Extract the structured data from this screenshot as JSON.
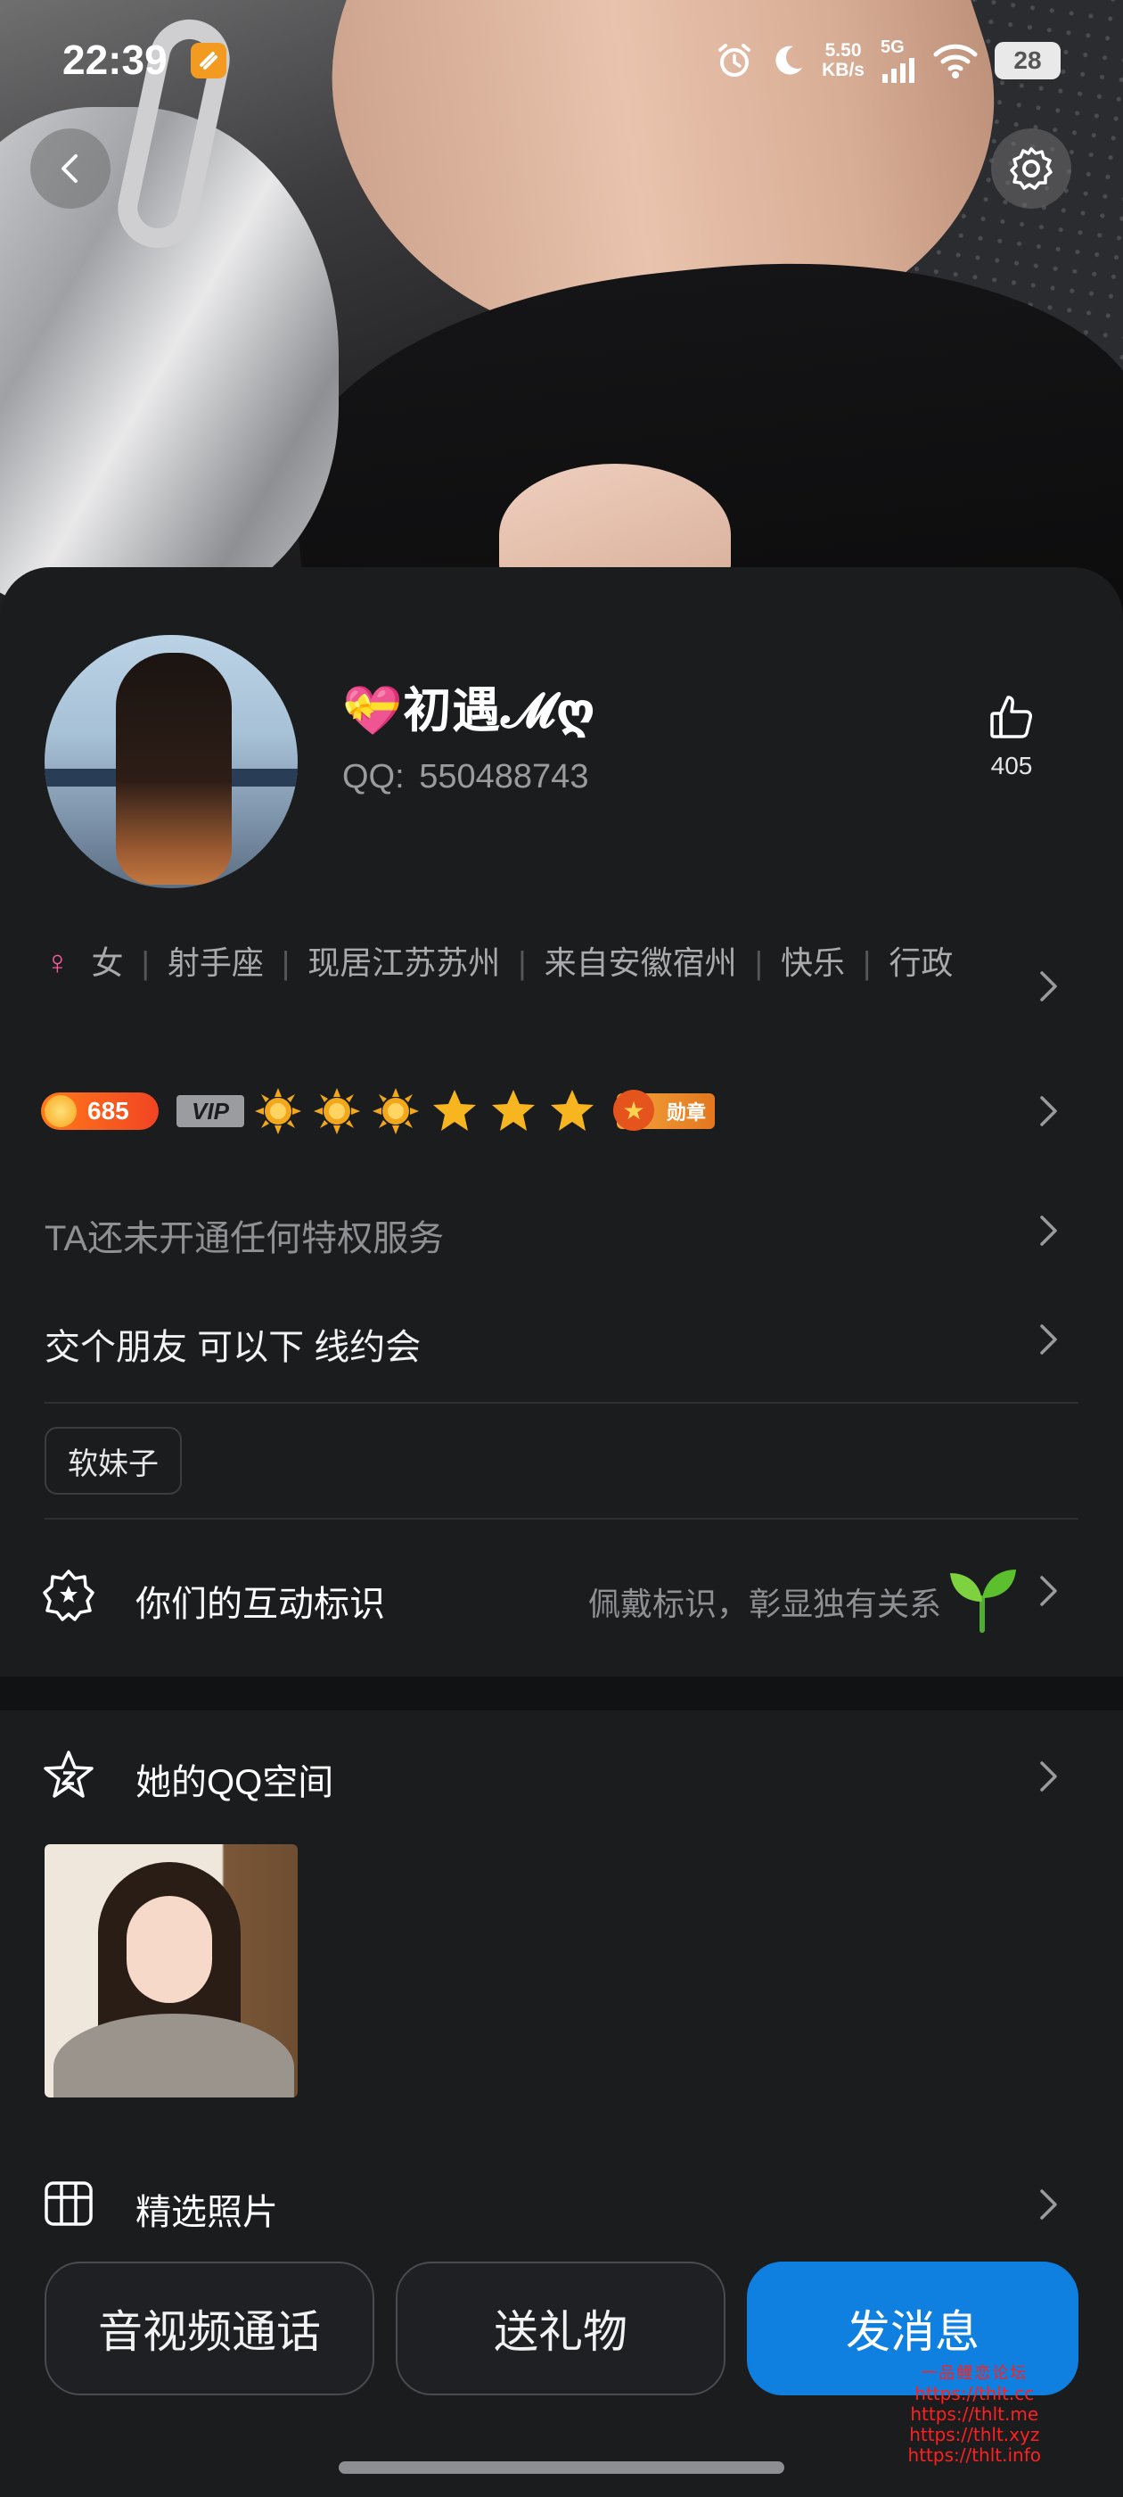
{
  "status_bar": {
    "time": "22:39",
    "net_speed_value": "5.50",
    "net_speed_unit": "KB/s",
    "network": "5G",
    "battery": "28"
  },
  "profile": {
    "nickname": "💝初遇𝓜ღ",
    "qq_label": "QQ:",
    "qq_number": "550488743",
    "like_count": "405"
  },
  "tags": [
    "女",
    "射手座",
    "现居江苏苏州",
    "来自安徽宿州",
    "快乐",
    "行政"
  ],
  "badges": {
    "level": "685",
    "vip": "VIP",
    "honor": "勋章"
  },
  "privilege_text": "TA还未开通任何特权服务",
  "signature": "交个朋友  可以下 线约会",
  "chip_tag": "软妹子",
  "interaction": {
    "label": "你们的互动标识",
    "hint": "佩戴标识，彰显独有关系"
  },
  "qzone": {
    "label": "她的QQ空间"
  },
  "photos": {
    "label": "精选照片"
  },
  "actions": {
    "call": "音视频通话",
    "gift": "送礼物",
    "message": "发消息"
  },
  "watermark": {
    "title": "一品鲤恋论坛",
    "urls": [
      "https://thlt.cc",
      "https://thlt.me",
      "https://thlt.xyz",
      "https://thlt.info"
    ]
  },
  "colors": {
    "accent": "#0f7fe0",
    "background": "#1b1c1e",
    "gender_female": "#f05d9b",
    "watermark": "#ff2020"
  }
}
